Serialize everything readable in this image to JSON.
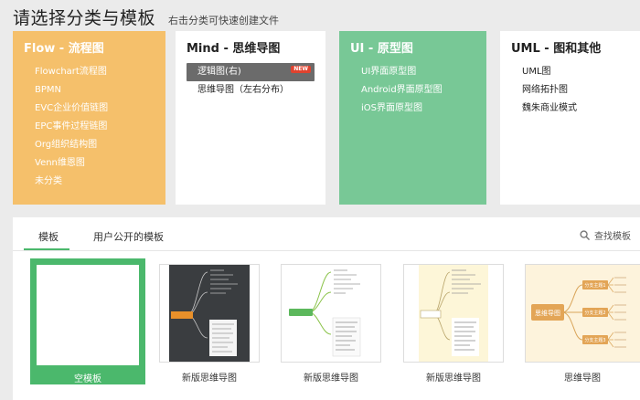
{
  "header": {
    "title": "请选择分类与模板",
    "subtitle": "右击分类可快速创建文件"
  },
  "categories": [
    {
      "title": "Flow - 流程图",
      "items": [
        "Flowchart流程图",
        "BPMN",
        "EVC企业价值链图",
        "EPC事件过程链图",
        "Org组织结构图",
        "Venn维恩图",
        "未分类"
      ]
    },
    {
      "title": "Mind - 思维导图",
      "items": [
        "逻辑图(右)",
        "思维导图（左右分布）"
      ],
      "active_index": 0,
      "badge": "NEW"
    },
    {
      "title": "UI - 原型图",
      "items": [
        "UI界面原型图",
        "Android界面原型图",
        "iOS界面原型图"
      ]
    },
    {
      "title": "UML - 图和其他",
      "items": [
        "UML图",
        "网络拓扑图",
        "魏朱商业模式"
      ]
    }
  ],
  "tabs": {
    "templates": "模板",
    "public": "用户公开的模板",
    "active": "templates"
  },
  "search": {
    "label": "查找模板"
  },
  "cards": [
    {
      "label": "空模板"
    },
    {
      "label": "新版思维导图"
    },
    {
      "label": "新版思维导图"
    },
    {
      "label": "新版思维导图"
    },
    {
      "label": "思维导图",
      "center_text": "思维导图",
      "branches": [
        "分支主题1",
        "分支主题2",
        "分支主题3"
      ]
    }
  ],
  "colors": {
    "flow": "#f5c06b",
    "ui": "#78c896",
    "accent_green": "#4bb86c",
    "active_item": "#6b6b6b",
    "badge": "#e0432f"
  }
}
